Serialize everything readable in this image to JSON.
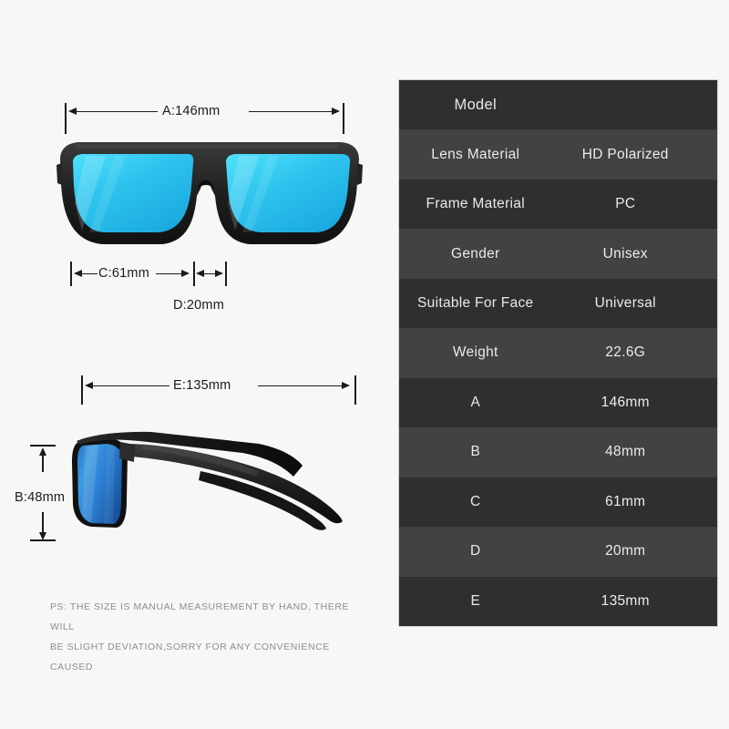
{
  "product": {
    "front_view_alt": "sunglasses-front-view",
    "side_view_alt": "sunglasses-side-view",
    "frame_color": "#1a1a1a",
    "lens_color_front": "#35ccf0",
    "lens_color_side": "#2b7fd4"
  },
  "dimensions": {
    "a": "A:146mm",
    "b": "B:48mm",
    "c": "C:61mm",
    "d": "D:20mm",
    "e": "E:135mm"
  },
  "note": {
    "line1": "PS: THE SIZE IS MANUAL MEASUREMENT BY HAND, THERE WILL",
    "line2": "BE SLIGHT DEVIATION,SORRY FOR ANY CONVENIENCE CAUSED"
  },
  "spec_table": {
    "rows": [
      {
        "label": "Model",
        "value": ""
      },
      {
        "label": "Lens Material",
        "value": "HD Polarized"
      },
      {
        "label": "Frame Material",
        "value": "PC"
      },
      {
        "label": "Gender",
        "value": "Unisex"
      },
      {
        "label": "Suitable For Face",
        "value": "Universal"
      },
      {
        "label": "Weight",
        "value": "22.6G"
      },
      {
        "label": "A",
        "value": "146mm"
      },
      {
        "label": "B",
        "value": "48mm"
      },
      {
        "label": "C",
        "value": "61mm"
      },
      {
        "label": "D",
        "value": "20mm"
      },
      {
        "label": "E",
        "value": "135mm"
      }
    ]
  },
  "colors": {
    "background": "#f7f7f5",
    "row_dark": "#2f2f2f",
    "row_light": "#424242",
    "text_light": "#e9e9e9",
    "dim_line": "#1b1b1b",
    "note_text": "#8e8e8e"
  }
}
